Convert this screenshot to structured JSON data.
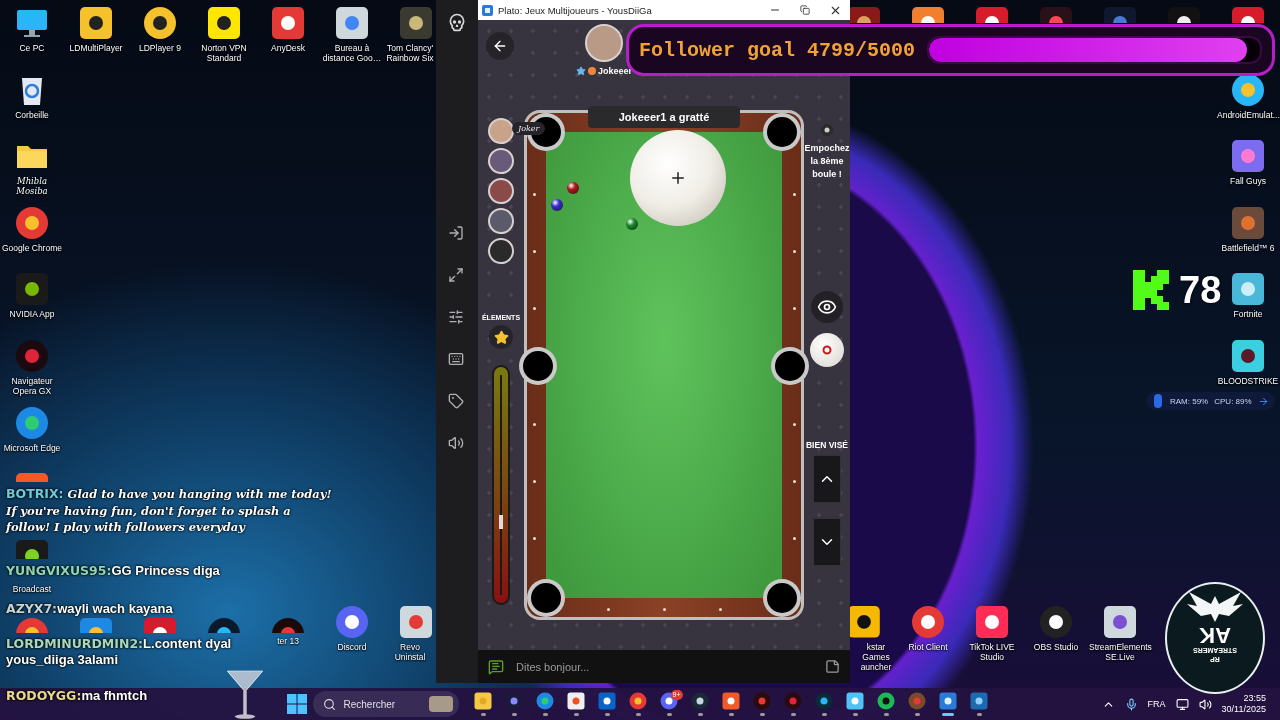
{
  "desktop": {
    "left_column": [
      {
        "label": "Ce PC",
        "kind": "monitor"
      },
      {
        "label": "Corbeille",
        "kind": "recycle"
      },
      {
        "label": "Mhibla Mosiba",
        "kind": "folder"
      },
      {
        "label": "Google Chrome",
        "kind": "chrome"
      },
      {
        "label": "NVIDIA App",
        "kind": "nvidia"
      },
      {
        "label": "Navigateur Opera GX",
        "kind": "opera"
      },
      {
        "label": "Microsoft Edge",
        "kind": "edge"
      },
      {
        "kind": "brave"
      },
      {
        "label": "Broadcast",
        "kind": "broadcast"
      }
    ],
    "top_row": [
      {
        "label": "LDMultiPlayer",
        "kind": "ldmulti"
      },
      {
        "label": "LDPlayer 9",
        "kind": "ldplayer"
      },
      {
        "label": "Norton VPN Standard",
        "kind": "norton"
      },
      {
        "label": "AnyDesk",
        "kind": "anydesk"
      },
      {
        "label": "Bureau à distance Goo…",
        "kind": "remote"
      },
      {
        "label": "Tom Clancy' Rainbow Six",
        "kind": "rainbow"
      }
    ],
    "top_right_row": [
      {
        "kind": "cowboy"
      },
      {
        "kind": "orange"
      },
      {
        "kind": "red"
      },
      {
        "kind": "valorant"
      },
      {
        "kind": "se"
      },
      {
        "kind": "dark"
      },
      {
        "kind": "apex"
      }
    ],
    "right_column": [
      {
        "label": "AndroidEmulat...",
        "kind": "android"
      },
      {
        "label": "Fall Guys",
        "kind": "fallguys"
      },
      {
        "label": "Battlefield™ 6",
        "kind": "battlefield"
      },
      {
        "label": "Fortnite",
        "kind": "fortnite"
      },
      {
        "label": "BLOODSTRIKE",
        "kind": "bloodstrike"
      }
    ],
    "bottom_left_row": [
      {
        "kind": "chrome"
      },
      {
        "kind": "setup"
      },
      {
        "kind": "red"
      },
      {
        "kind": "systemcare"
      },
      {
        "label": "ter 13",
        "kind": "iobit"
      },
      {
        "label": "Discord",
        "kind": "discord"
      },
      {
        "label": "Revo Uninstal",
        "kind": "revo"
      }
    ],
    "bottom_right_row": [
      {
        "label": "kstar Games auncher",
        "kind": "rockstar"
      },
      {
        "label": "Riot Client",
        "kind": "riot"
      },
      {
        "label": "TikTok LIVE Studio",
        "kind": "tiktok"
      },
      {
        "label": "OBS Studio",
        "kind": "obs"
      },
      {
        "label": "StreamElements SE.Live",
        "kind": "streamelements"
      }
    ]
  },
  "window": {
    "title": "Plato: Jeux Multijoueurs - YousDiiGa",
    "player_name": "Jokeeer",
    "banner": "Jokeeer1 a gratté",
    "opponent_tag": "Joker",
    "elements_label": "ÉLEMENTS",
    "hint": "Empochez la 8ème boule !",
    "aim_label": "BIEN VISÉ",
    "chat_placeholder": "Dites bonjour..."
  },
  "follower_goal": {
    "text": "Follower goal 4799/5000",
    "level": 0.96
  },
  "kick": {
    "count": "78"
  },
  "system_monitor": {
    "ram": "RAM: 59%",
    "cpu": "CPU: 89%"
  },
  "chat": [
    {
      "kind": "bot",
      "user": "BOTRIX:",
      "message": "Glad to have you hanging with me today! If you're having fun, don't forget to splash a follow! I play with followers everyday",
      "color": "#6fc9d8"
    },
    {
      "kind": "user",
      "user": "YUNGVIXUS95:",
      "message": "GG Princess diga",
      "color": "#8fd6b0"
    },
    {
      "kind": "user",
      "user": "AZYX7:",
      "message": "wayli wach kayana",
      "color": "#c9d4d0"
    },
    {
      "kind": "user",
      "user": "LORDMINURDMIN2:",
      "message": "L.content dyal yous_diiga 3alami",
      "color": "#a8d8b8"
    },
    {
      "kind": "user",
      "user": "RODOYGG:",
      "message": "ma fhmtch",
      "color": "#e8d88a"
    }
  ],
  "stream_logo": {
    "title": "AK",
    "subtitle": "STREAMERS",
    "tag": "RP"
  },
  "taskbar": {
    "search_placeholder": "Rechercher",
    "apps": [
      {
        "kind": "explorer",
        "active": false
      },
      {
        "kind": "ring",
        "active": false
      },
      {
        "kind": "edge",
        "active": false
      },
      {
        "kind": "store",
        "active": false
      },
      {
        "kind": "mail",
        "active": false
      },
      {
        "kind": "chrome",
        "active": false
      },
      {
        "kind": "discord",
        "active": false,
        "badge": "9+"
      },
      {
        "kind": "steam",
        "active": false
      },
      {
        "kind": "brave",
        "active": false
      },
      {
        "kind": "redapp",
        "active": false
      },
      {
        "kind": "opera",
        "active": false
      },
      {
        "kind": "ccleaner",
        "active": false
      },
      {
        "kind": "notepad",
        "active": false
      },
      {
        "kind": "spotify",
        "active": false
      },
      {
        "kind": "game",
        "active": false
      },
      {
        "kind": "plato",
        "active": true
      },
      {
        "kind": "monitor",
        "active": false
      }
    ],
    "language": "FRA",
    "time": "23:55",
    "date": "30/11/2025"
  }
}
